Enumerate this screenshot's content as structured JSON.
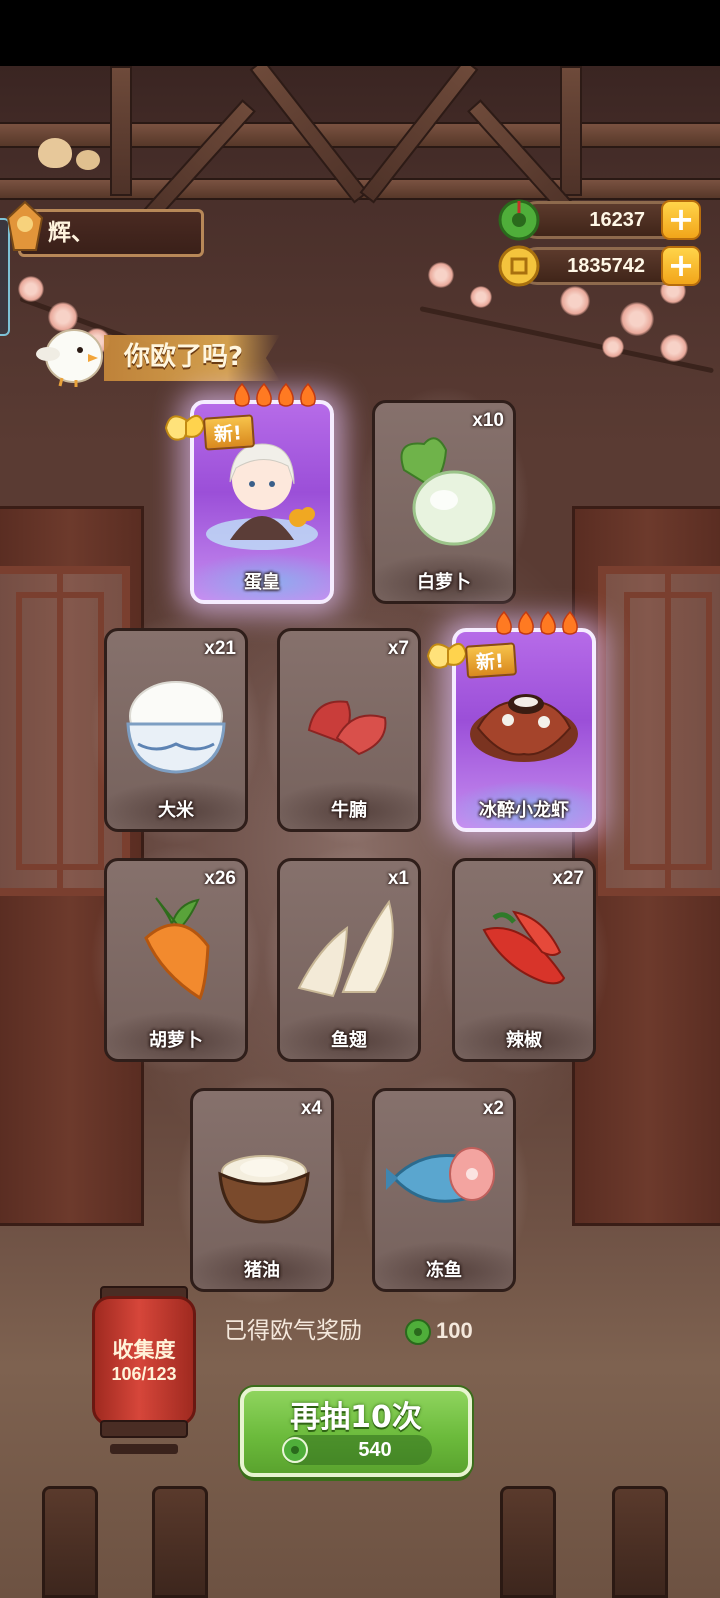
{
  "player": {
    "name": "辉、"
  },
  "currencies": {
    "jade": {
      "icon": "green-jade-coin-icon",
      "value": "16237",
      "add_label": "+"
    },
    "gold": {
      "icon": "gold-coin-icon",
      "value": "1835742",
      "add_label": "+"
    }
  },
  "banner": {
    "text": "你欧了吗?"
  },
  "cards": [
    {
      "name": "蛋皇",
      "qty": "",
      "rare": true,
      "new": true,
      "new_label": "新!",
      "flames": 4,
      "art": "chef-character"
    },
    {
      "name": "白萝卜",
      "qty": "x10",
      "rare": false,
      "new": false,
      "art": "radish"
    },
    {
      "name": "大米",
      "qty": "x21",
      "rare": false,
      "new": false,
      "art": "rice-bowl"
    },
    {
      "name": "牛腩",
      "qty": "x7",
      "rare": false,
      "new": false,
      "art": "beef"
    },
    {
      "name": "冰醉小龙虾",
      "qty": "",
      "rare": true,
      "new": true,
      "new_label": "新!",
      "flames": 4,
      "art": "crayfish-dish"
    },
    {
      "name": "胡萝卜",
      "qty": "x26",
      "rare": false,
      "new": false,
      "art": "carrot"
    },
    {
      "name": "鱼翅",
      "qty": "x1",
      "rare": false,
      "new": false,
      "art": "shark-fin"
    },
    {
      "name": "辣椒",
      "qty": "x27",
      "rare": false,
      "new": false,
      "art": "chili"
    },
    {
      "name": "猪油",
      "qty": "x4",
      "rare": false,
      "new": false,
      "art": "lard-bowl"
    },
    {
      "name": "冻鱼",
      "qty": "x2",
      "rare": false,
      "new": false,
      "art": "frozen-fish"
    }
  ],
  "collection": {
    "label": "收集度",
    "progress": "106/123"
  },
  "bonus": {
    "label": "已得欧气奖励",
    "value": "100"
  },
  "draw_button": {
    "label": "再抽10次",
    "cost": "540"
  },
  "colors": {
    "rare_card": "#9b4fd8",
    "normal_card": "#76625d",
    "draw_button": "#6cbb3c",
    "lantern": "#d6463a"
  }
}
